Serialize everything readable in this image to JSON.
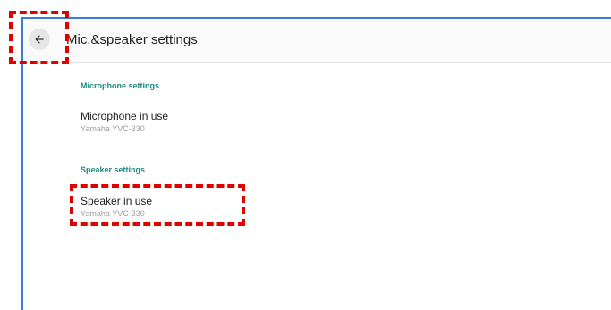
{
  "header": {
    "title": "Mic.&speaker settings",
    "back_icon": "arrow-left-icon"
  },
  "sections": [
    {
      "title": "Microphone settings",
      "item": {
        "title": "Microphone in use",
        "value": "Yamaha YVC-330"
      }
    },
    {
      "title": "Speaker settings",
      "item": {
        "title": "Speaker in use",
        "value": "Yamaha YVC-330"
      }
    }
  ],
  "colors": {
    "accent": "#1e8a80",
    "frame_border": "#3a7bd5",
    "highlight": "#e00000"
  }
}
